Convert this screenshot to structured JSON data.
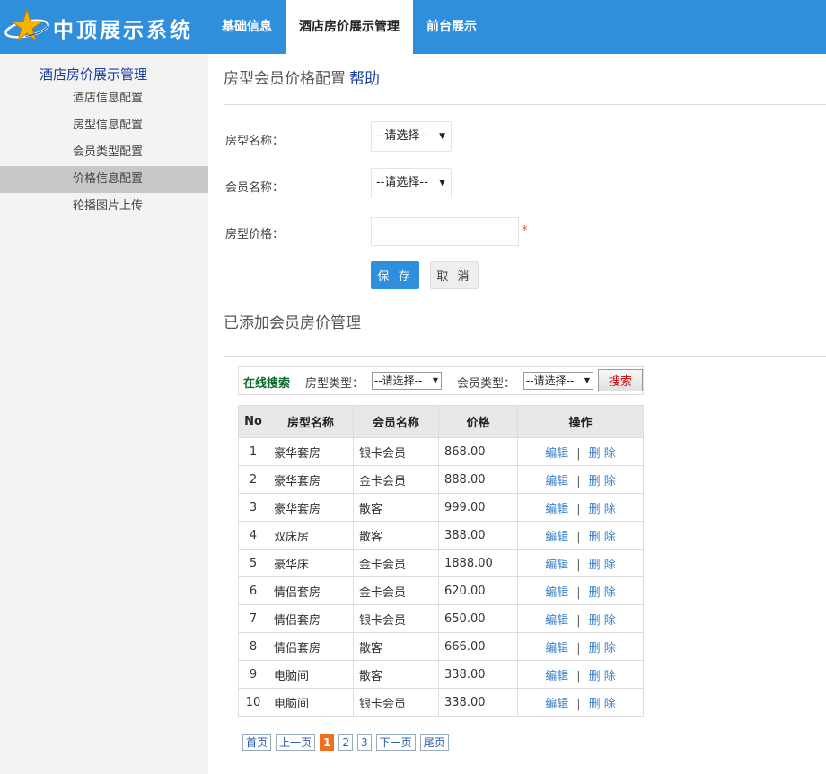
{
  "header": {
    "site_title": "中顶展示系统",
    "nav": [
      {
        "label": "基础信息"
      },
      {
        "label": "酒店房价展示管理",
        "active": true
      },
      {
        "label": "前台展示"
      }
    ],
    "accent_color": "#2f8fdc"
  },
  "sidebar": {
    "heading": "酒店房价展示管理",
    "items": [
      {
        "label": "酒店信息配置"
      },
      {
        "label": "房型信息配置"
      },
      {
        "label": "会员类型配置"
      },
      {
        "label": "价格信息配置",
        "active": true
      },
      {
        "label": "轮播图片上传"
      }
    ]
  },
  "form": {
    "title": "房型会员价格配置",
    "help": "帮助",
    "room_name_label": "房型名称：",
    "room_name_value": "--请选择--",
    "member_name_label": "会员名称：",
    "member_name_value": "--请选择--",
    "price_label": "房型价格：",
    "price_value": "",
    "required_mark": "*",
    "save_label": "保 存",
    "cancel_label": "取 消"
  },
  "list": {
    "title": "已添加会员房价管理",
    "search": {
      "title": "在线搜索",
      "room_type_label": "房型类型：",
      "room_type_value": "--请选择--",
      "member_type_label": "会员类型：",
      "member_type_value": "--请选择--",
      "button": "搜索"
    },
    "columns": [
      "No",
      "房型名称",
      "会员名称",
      "价格",
      "操作"
    ],
    "rows": [
      {
        "no": "1",
        "room": "豪华套房",
        "member": "银卡会员",
        "price": "868.00"
      },
      {
        "no": "2",
        "room": "豪华套房",
        "member": "金卡会员",
        "price": "888.00"
      },
      {
        "no": "3",
        "room": "豪华套房",
        "member": "散客",
        "price": "999.00"
      },
      {
        "no": "4",
        "room": "双床房",
        "member": "散客",
        "price": "388.00"
      },
      {
        "no": "5",
        "room": "豪华床",
        "member": "金卡会员",
        "price": "1888.00"
      },
      {
        "no": "6",
        "room": "情侣套房",
        "member": "金卡会员",
        "price": "620.00"
      },
      {
        "no": "7",
        "room": "情侣套房",
        "member": "银卡会员",
        "price": "650.00"
      },
      {
        "no": "8",
        "room": "情侣套房",
        "member": "散客",
        "price": "666.00"
      },
      {
        "no": "9",
        "room": "电脑间",
        "member": "散客",
        "price": "338.00"
      },
      {
        "no": "10",
        "room": "电脑间",
        "member": "银卡会员",
        "price": "338.00"
      }
    ],
    "op_edit": "编辑",
    "op_sep": "|",
    "op_delete": "删 除",
    "pager": {
      "first": "首页",
      "prev": "上一页",
      "pages": [
        "1",
        "2",
        "3"
      ],
      "current": "1",
      "next": "下一页",
      "last": "尾页"
    }
  }
}
